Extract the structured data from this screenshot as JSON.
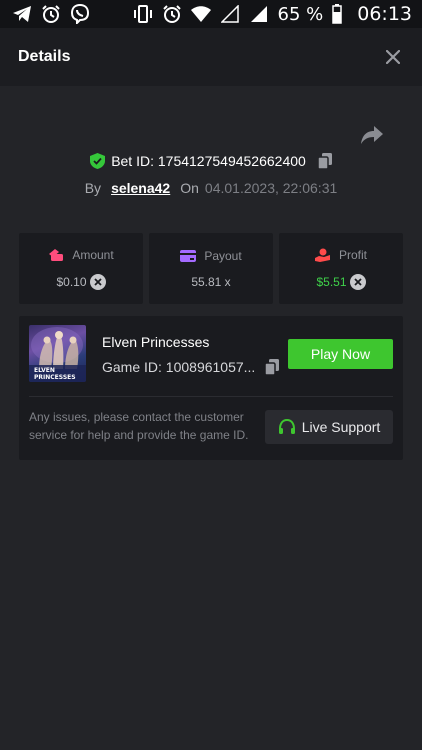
{
  "status_bar": {
    "battery": "65 %",
    "time": "06:13",
    "icons_left": [
      "telegram-icon",
      "alarm-icon",
      "viber-icon"
    ],
    "icons_right": [
      "vibrate-icon",
      "alarm-icon",
      "wifi-icon",
      "signal-empty-icon",
      "signal-icon",
      "battery-icon"
    ]
  },
  "header": {
    "title": "Details"
  },
  "bet": {
    "id_label": "Bet ID: 1754127549452662400",
    "by_label": "By",
    "username": "selena42",
    "on_label": "On",
    "datetime": "04.01.2023, 22:06:31"
  },
  "stats": [
    {
      "label": "Amount",
      "value": "$0.10",
      "icon": "wallet-icon",
      "color": "#ff4d7d"
    },
    {
      "label": "Payout",
      "value": "55.81 x",
      "icon": "card-icon",
      "color": "#a46bff"
    },
    {
      "label": "Profit",
      "value": "$5.51",
      "icon": "profit-hand-icon",
      "color": "#ff4b4b"
    }
  ],
  "game": {
    "name": "Elven Princesses",
    "id_label": "Game ID: 1008961057...",
    "thumb_line1": "ELVEN",
    "thumb_line2": "PRINCESSES",
    "play_label": "Play Now"
  },
  "support": {
    "help_text": "Any issues, please contact the customer service for help and provide the game ID.",
    "button_label": "Live Support"
  },
  "colors": {
    "accent_green": "#3ec62f",
    "profit_green": "#3fd14a",
    "background": "#232428",
    "card": "#1a1b1f"
  }
}
